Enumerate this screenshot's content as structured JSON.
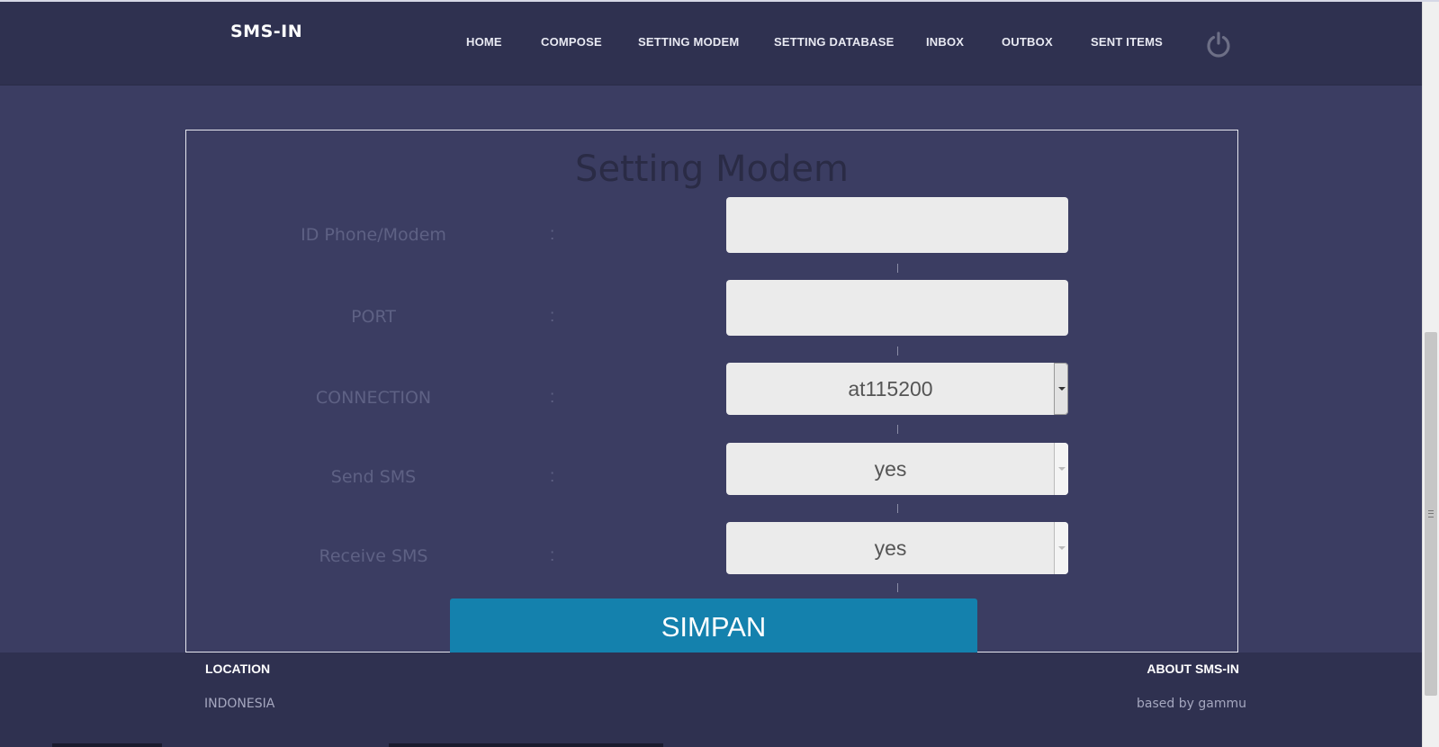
{
  "app": {
    "brand": "SMS-IN"
  },
  "nav": {
    "items": [
      {
        "label": "HOME",
        "name": "nav-home"
      },
      {
        "label": "COMPOSE",
        "name": "nav-compose"
      },
      {
        "label": "SETTING MODEM",
        "name": "nav-setting-modem"
      },
      {
        "label": "SETTING DATABASE",
        "name": "nav-setting-database"
      },
      {
        "label": "INBOX",
        "name": "nav-inbox"
      },
      {
        "label": "OUTBOX",
        "name": "nav-outbox"
      },
      {
        "label": "SENT ITEMS",
        "name": "nav-sent-items"
      }
    ],
    "power_icon": "power-icon"
  },
  "form": {
    "title": "Setting Modem",
    "colon": ":",
    "fields": {
      "id_phone": {
        "label": "ID Phone/Modem",
        "value": ""
      },
      "port": {
        "label": "PORT",
        "value": ""
      },
      "connection": {
        "label": "CONNECTION",
        "value": "at115200"
      },
      "send_sms": {
        "label": "Send SMS",
        "value": "yes"
      },
      "receive_sms": {
        "label": "Receive SMS",
        "value": "yes"
      }
    },
    "submit_label": "SIMPAN"
  },
  "footer": {
    "location_heading": "LOCATION",
    "location_value": "INDONESIA",
    "about_heading": "ABOUT SMS-IN",
    "about_value": "based by gammu"
  },
  "colors": {
    "navbar": "#2f3150",
    "page_bg": "#3b3d62",
    "button": "#1481ad"
  }
}
